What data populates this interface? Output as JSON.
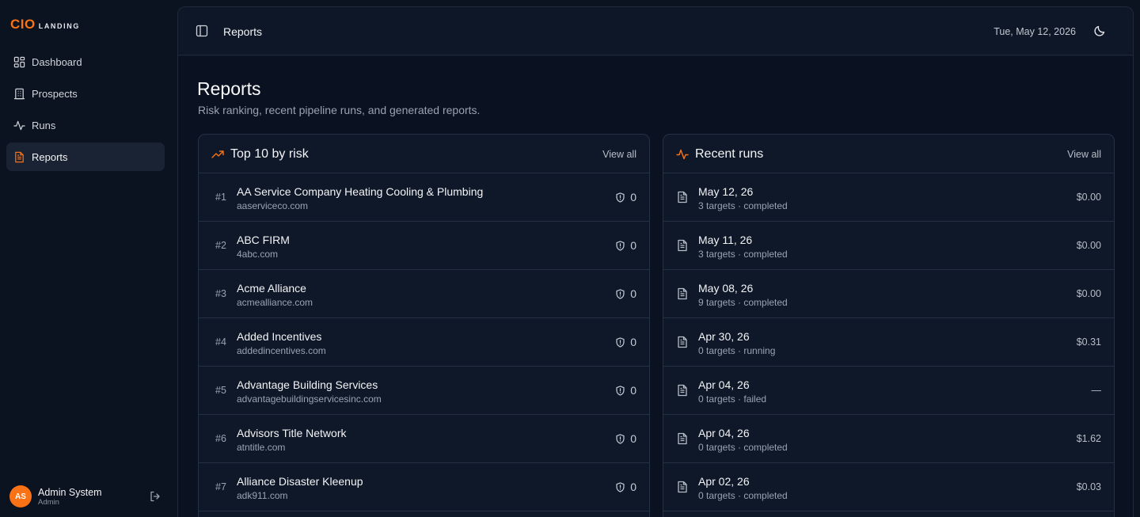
{
  "brand": {
    "name": "CIO",
    "suffix": "LANDING",
    "accent": "#f97316"
  },
  "nav": [
    {
      "label": "Dashboard",
      "icon": "dashboard-grid-icon"
    },
    {
      "label": "Prospects",
      "icon": "building-icon"
    },
    {
      "label": "Runs",
      "icon": "activity-icon"
    },
    {
      "label": "Reports",
      "icon": "document-icon",
      "active": true
    }
  ],
  "user": {
    "initials": "AS",
    "name": "Admin System",
    "role": "Admin"
  },
  "topbar": {
    "breadcrumb": "Reports",
    "date": "Tue, May 12, 2026"
  },
  "page": {
    "title": "Reports",
    "subtitle": "Risk ranking, recent pipeline runs, and generated reports."
  },
  "top_risk": {
    "title": "Top 10 by risk",
    "view_all": "View all",
    "rows": [
      {
        "rank": "#1",
        "name": "AA Service Company Heating Cooling & Plumbing",
        "domain": "aaserviceco.com",
        "score": "0"
      },
      {
        "rank": "#2",
        "name": "ABC FIRM",
        "domain": "4abc.com",
        "score": "0"
      },
      {
        "rank": "#3",
        "name": "Acme Alliance",
        "domain": "acmealliance.com",
        "score": "0"
      },
      {
        "rank": "#4",
        "name": "Added Incentives",
        "domain": "addedincentives.com",
        "score": "0"
      },
      {
        "rank": "#5",
        "name": "Advantage Building Services",
        "domain": "advantagebuildingservicesinc.com",
        "score": "0"
      },
      {
        "rank": "#6",
        "name": "Advisors Title Network",
        "domain": "atntitle.com",
        "score": "0"
      },
      {
        "rank": "#7",
        "name": "Alliance Disaster Kleenup",
        "domain": "adk911.com",
        "score": "0"
      }
    ]
  },
  "recent_runs": {
    "title": "Recent runs",
    "view_all": "View all",
    "rows": [
      {
        "date": "May 12, 26",
        "detail": "3 targets · completed",
        "cost": "$0.00"
      },
      {
        "date": "May 11, 26",
        "detail": "3 targets · completed",
        "cost": "$0.00"
      },
      {
        "date": "May 08, 26",
        "detail": "9 targets · completed",
        "cost": "$0.00"
      },
      {
        "date": "Apr 30, 26",
        "detail": "0 targets · running",
        "cost": "$0.31"
      },
      {
        "date": "Apr 04, 26",
        "detail": "0 targets · failed",
        "cost": "—"
      },
      {
        "date": "Apr 04, 26",
        "detail": "0 targets · completed",
        "cost": "$1.62"
      },
      {
        "date": "Apr 02, 26",
        "detail": "0 targets · completed",
        "cost": "$0.03"
      }
    ]
  }
}
